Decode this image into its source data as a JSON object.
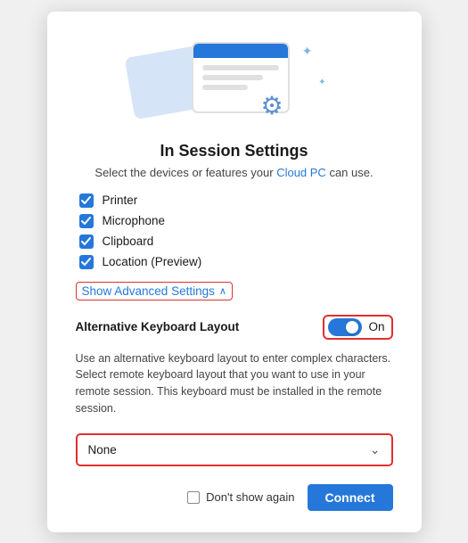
{
  "dialog": {
    "title": "In Session Settings",
    "subtitle_pre": "Select the devices or features your ",
    "subtitle_link": "Cloud PC",
    "subtitle_post": " can use.",
    "checkboxes": [
      {
        "label": "Printer",
        "checked": true
      },
      {
        "label": "Microphone",
        "checked": true
      },
      {
        "label": "Clipboard",
        "checked": true
      },
      {
        "label": "Location (Preview)",
        "checked": true
      }
    ],
    "show_advanced_label": "Show Advanced Settings",
    "advanced": {
      "keyboard_layout_label": "Alternative Keyboard Layout",
      "toggle_state": "On",
      "keyboard_desc": "Use an alternative keyboard layout to enter complex characters. Select remote keyboard layout that you want to use in your remote session. This keyboard must be installed in the remote session.",
      "dropdown_value": "None",
      "dropdown_placeholder": "None"
    },
    "footer": {
      "dont_show_label": "Don't show again",
      "connect_label": "Connect"
    }
  }
}
